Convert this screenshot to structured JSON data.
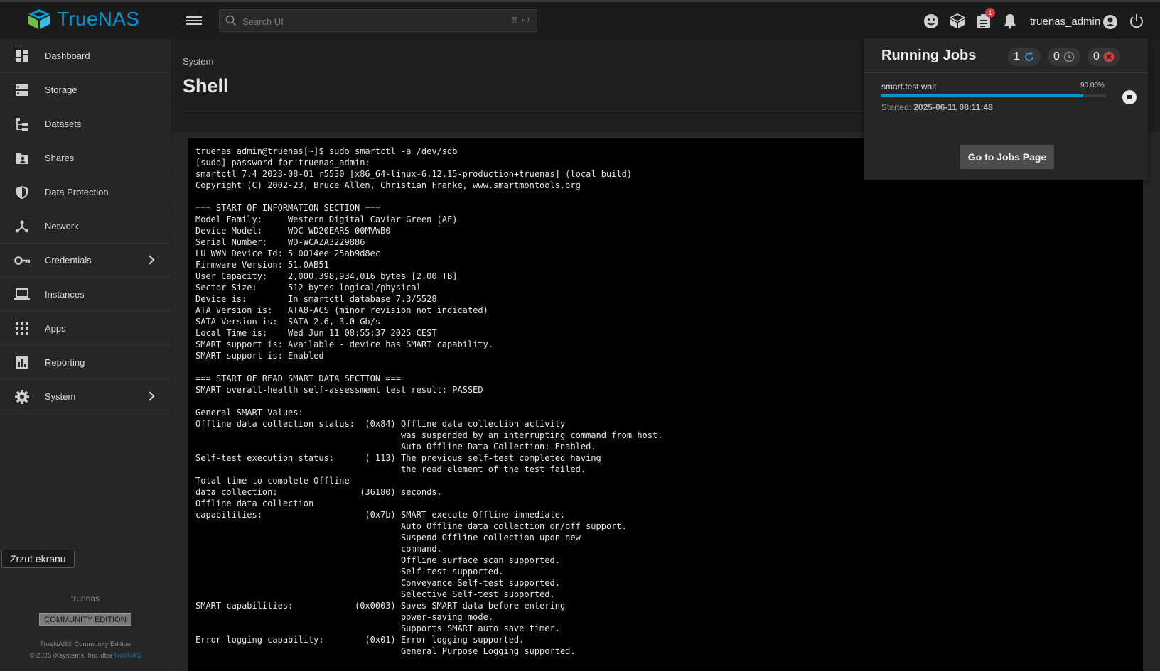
{
  "header": {
    "logo_text": "TrueNAS",
    "search_placeholder": "Search UI",
    "search_shortcut": "⌘ + /",
    "notification_badge": "1",
    "username": "truenas_admin"
  },
  "sidebar": {
    "items": [
      {
        "label": "Dashboard",
        "icon": "dashboard-icon"
      },
      {
        "label": "Storage",
        "icon": "storage-icon"
      },
      {
        "label": "Datasets",
        "icon": "datasets-icon"
      },
      {
        "label": "Shares",
        "icon": "shares-icon"
      },
      {
        "label": "Data Protection",
        "icon": "shield-icon"
      },
      {
        "label": "Network",
        "icon": "network-icon"
      },
      {
        "label": "Credentials",
        "icon": "key-icon"
      },
      {
        "label": "Instances",
        "icon": "laptop-icon"
      },
      {
        "label": "Apps",
        "icon": "apps-grid-icon"
      },
      {
        "label": "Reporting",
        "icon": "reporting-icon"
      },
      {
        "label": "System",
        "icon": "gear-icon"
      }
    ],
    "tooltip": "Zrzut ekranu",
    "hostname": "truenas",
    "edition": "COMMUNITY EDITION",
    "footer_line1": "TrueNAS® Community Edition",
    "footer_line2_prefix": "© 2025 iXsystems, Inc. dba ",
    "footer_link": "TrueNAS"
  },
  "main": {
    "breadcrumb": "System",
    "title": "Shell",
    "terminal_lines": [
      "truenas_admin@truenas[~]$ sudo smartctl -a /dev/sdb",
      "[sudo] password for truenas_admin:",
      "smartctl 7.4 2023-08-01 r5530 [x86_64-linux-6.12.15-production+truenas] (local build)",
      "Copyright (C) 2002-23, Bruce Allen, Christian Franke, www.smartmontools.org",
      "",
      "=== START OF INFORMATION SECTION ===",
      "Model Family:     Western Digital Caviar Green (AF)",
      "Device Model:     WDC WD20EARS-00MVWB0",
      "Serial Number:    WD-WCAZA3229886",
      "LU WWN Device Id: 5 0014ee 25ab9d8ec",
      "Firmware Version: 51.0AB51",
      "User Capacity:    2,000,398,934,016 bytes [2.00 TB]",
      "Sector Size:      512 bytes logical/physical",
      "Device is:        In smartctl database 7.3/5528",
      "ATA Version is:   ATA8-ACS (minor revision not indicated)",
      "SATA Version is:  SATA 2.6, 3.0 Gb/s",
      "Local Time is:    Wed Jun 11 08:55:37 2025 CEST",
      "SMART support is: Available - device has SMART capability.",
      "SMART support is: Enabled",
      "",
      "=== START OF READ SMART DATA SECTION ===",
      "SMART overall-health self-assessment test result: PASSED",
      "",
      "General SMART Values:",
      "Offline data collection status:  (0x84) Offline data collection activity",
      "                                        was suspended by an interrupting command from host.",
      "                                        Auto Offline Data Collection: Enabled.",
      "Self-test execution status:      ( 113) The previous self-test completed having",
      "                                        the read element of the test failed.",
      "Total time to complete Offline",
      "data collection:                (36180) seconds.",
      "Offline data collection",
      "capabilities:                    (0x7b) SMART execute Offline immediate.",
      "                                        Auto Offline data collection on/off support.",
      "                                        Suspend Offline collection upon new",
      "                                        command.",
      "                                        Offline surface scan supported.",
      "                                        Self-test supported.",
      "                                        Conveyance Self-test supported.",
      "                                        Selective Self-test supported.",
      "SMART capabilities:            (0x0003) Saves SMART data before entering",
      "                                        power-saving mode.",
      "                                        Supports SMART auto save timer.",
      "Error logging capability:        (0x01) Error logging supported.",
      "                                        General Purpose Logging supported."
    ]
  },
  "jobs": {
    "title": "Running Jobs",
    "counters": [
      {
        "count": "1",
        "icon": "sync-icon",
        "color": "#2a9bd6"
      },
      {
        "count": "0",
        "icon": "clock-icon",
        "color": "#8a8a8a"
      },
      {
        "count": "0",
        "icon": "error-icon",
        "color": "#d63a3a"
      }
    ],
    "job_name": "smart.test.wait",
    "progress_label": "90.00%",
    "progress": 0.9,
    "started_label": "Started:",
    "started_value": "2025-06-11 08:11:48",
    "button_label": "Go to Jobs Page"
  },
  "colors": {
    "accent": "#0095d5",
    "badge": "#d63a3a"
  }
}
